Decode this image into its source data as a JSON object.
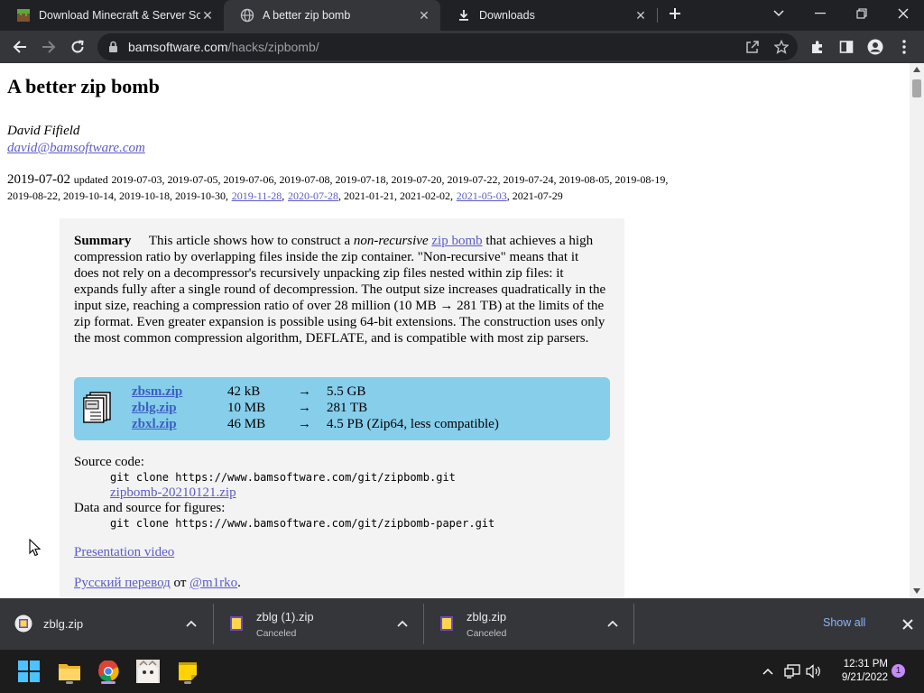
{
  "tabs": [
    {
      "title": "Download Minecraft & Server So",
      "icon": "minecraft-grass-icon"
    },
    {
      "title": "A better zip bomb",
      "icon": "globe-icon",
      "active": true
    },
    {
      "title": "Downloads",
      "icon": "download-icon"
    }
  ],
  "omnibox": {
    "host": "bamsoftware.com",
    "path": "/hacks/zipbomb/"
  },
  "article": {
    "title": "A better zip bomb",
    "author": "David Fifield",
    "email": "david@bamsoftware.com",
    "date": "2019-07-02",
    "updated_label": "updated",
    "updates_plain_1": "2019-07-03, 2019-07-05, 2019-07-06, 2019-07-08, 2019-07-18, 2019-07-20, 2019-07-22, 2019-07-24, 2019-08-05, 2019-08-19, 2019-08-22, 2019-10-14, 2019-10-18, 2019-10-30,",
    "update_link_1": "2019-11-28",
    "update_link_2": "2020-07-28",
    "updates_plain_2": ", 2021-01-21, 2021-02-02,",
    "update_link_3": "2021-05-03",
    "updates_plain_3": ", 2021-07-29",
    "summary_label": "Summary",
    "summary_pre": "This article shows how to construct a",
    "summary_em": "non-recursive",
    "summary_link": "zip bomb",
    "summary_post": "that achieves a high compression ratio by overlapping files inside the zip container. \"Non-recursive\" means that it does not rely on a decompressor's recursively unpacking zip files nested within zip files: it expands fully after a single round of decompression. The output size increases quadratically in the input size, reaching a compression ratio of over 28 million (10 MB → 281 TB) at the limits of the zip format. Even greater expansion is possible using 64-bit extensions. The construction uses only the most common compression algorithm, DEFLATE, and is compatible with most zip parsers.",
    "files": [
      {
        "name": "zbsm.zip",
        "size": "42 kB",
        "arrow": "→",
        "output": "5.5 GB"
      },
      {
        "name": "zblg.zip",
        "size": "10 MB",
        "arrow": "→",
        "output": "281 TB"
      },
      {
        "name": "zbxl.zip",
        "size": "46 MB",
        "arrow": "→",
        "output": "4.5 PB (Zip64, less compatible)"
      }
    ],
    "source_label": "Source code:",
    "source_cmd": "git clone https://www.bamsoftware.com/git/zipbomb.git",
    "source_zip": "zipbomb-20210121.zip",
    "data_label": "Data and source for figures:",
    "data_cmd": "git clone https://www.bamsoftware.com/git/zipbomb-paper.git",
    "presentation": "Presentation video",
    "russian_link": "Русский перевод",
    "russian_from": "от",
    "russian_author": "@m1rko",
    "russian_end": "."
  },
  "downloads": [
    {
      "name": "zblg.zip",
      "status": ""
    },
    {
      "name": "zblg (1).zip",
      "status": "Canceled"
    },
    {
      "name": "zblg.zip",
      "status": "Canceled"
    }
  ],
  "shelf": {
    "show_all": "Show all"
  },
  "clock": {
    "time": "12:31 PM",
    "date": "9/21/2022"
  },
  "notifications": "1",
  "colors": {
    "tab_strip": "#202124",
    "toolbar": "#35363a",
    "link": "#5b5bc7",
    "files_box": "#87ceeb",
    "show_all": "#8ab4f8"
  }
}
